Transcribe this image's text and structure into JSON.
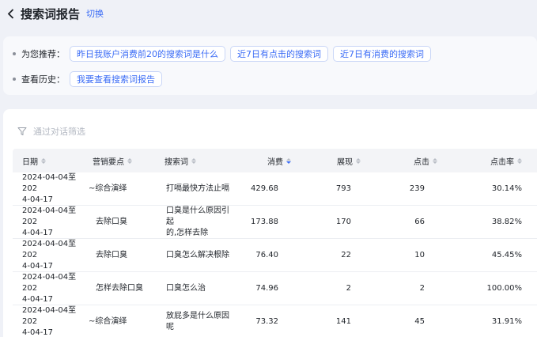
{
  "header": {
    "title": "搜索词报告",
    "switch_label": "切换"
  },
  "recommend": {
    "label": "为您推荐：",
    "chips": [
      "昨日我账户消费前20的搜索词是什么",
      "近7日有点击的搜索词",
      "近7日有消费的搜索词"
    ]
  },
  "history": {
    "label": "查看历史：",
    "chips": [
      "我要查看搜索词报告"
    ]
  },
  "filter": {
    "placeholder": "通过对话筛选"
  },
  "table": {
    "columns": [
      "日期",
      "营销要点",
      "搜索词",
      "消费",
      "展现",
      "点击",
      "点击率"
    ],
    "active_sort": "消费",
    "rows": [
      {
        "date_l1": "2024-04-04至202",
        "date_l2": "4-04-17",
        "point": "~综合演绎",
        "term_l1": "打嗝最快方法止嗝",
        "term_l2": "",
        "cost": "429.68",
        "show": "793",
        "click": "239",
        "ctr": "30.14%"
      },
      {
        "date_l1": "2024-04-04至202",
        "date_l2": "4-04-17",
        "point": "去除口臭",
        "term_l1": "口臭是什么原因引起",
        "term_l2": "的,怎样去除",
        "cost": "173.88",
        "show": "170",
        "click": "66",
        "ctr": "38.82%"
      },
      {
        "date_l1": "2024-04-04至202",
        "date_l2": "4-04-17",
        "point": "去除口臭",
        "term_l1": "口臭怎么解决根除",
        "term_l2": "",
        "cost": "76.40",
        "show": "22",
        "click": "10",
        "ctr": "45.45%"
      },
      {
        "date_l1": "2024-04-04至202",
        "date_l2": "4-04-17",
        "point": "怎样去除口臭",
        "term_l1": "口臭怎么治",
        "term_l2": "",
        "cost": "74.96",
        "show": "2",
        "click": "2",
        "ctr": "100.00%"
      },
      {
        "date_l1": "2024-04-04至202",
        "date_l2": "4-04-17",
        "point": "~综合演绎",
        "term_l1": "放屁多是什么原因呢",
        "term_l2": "",
        "cost": "73.32",
        "show": "141",
        "click": "45",
        "ctr": "31.91%"
      }
    ]
  },
  "colors": {
    "accent": "#3b6cf6",
    "background": "#eff1f7",
    "header_row": "#f3f4f7"
  }
}
